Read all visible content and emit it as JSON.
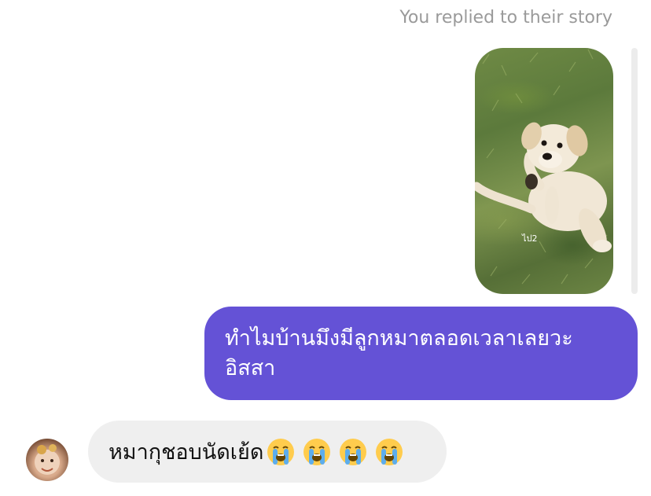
{
  "story": {
    "reply_label": "You replied to their story",
    "thumbnail_caption": "ไป2"
  },
  "messages": {
    "outgoing": {
      "text_line1": "ทำไมบ้านมึงมีลูกหมาตลอดเวลาเลยวะ",
      "text_line2": "อิสสา"
    },
    "incoming": {
      "text": "หมากุชอบนัดเย้ด",
      "emojis": [
        "loudly-crying-face",
        "loudly-crying-face",
        "loudly-crying-face",
        "loudly-crying-face"
      ]
    }
  },
  "colors": {
    "outgoing_bubble": "#6452d6",
    "incoming_bubble": "#efefef",
    "meta_text": "#9a9a9a"
  }
}
